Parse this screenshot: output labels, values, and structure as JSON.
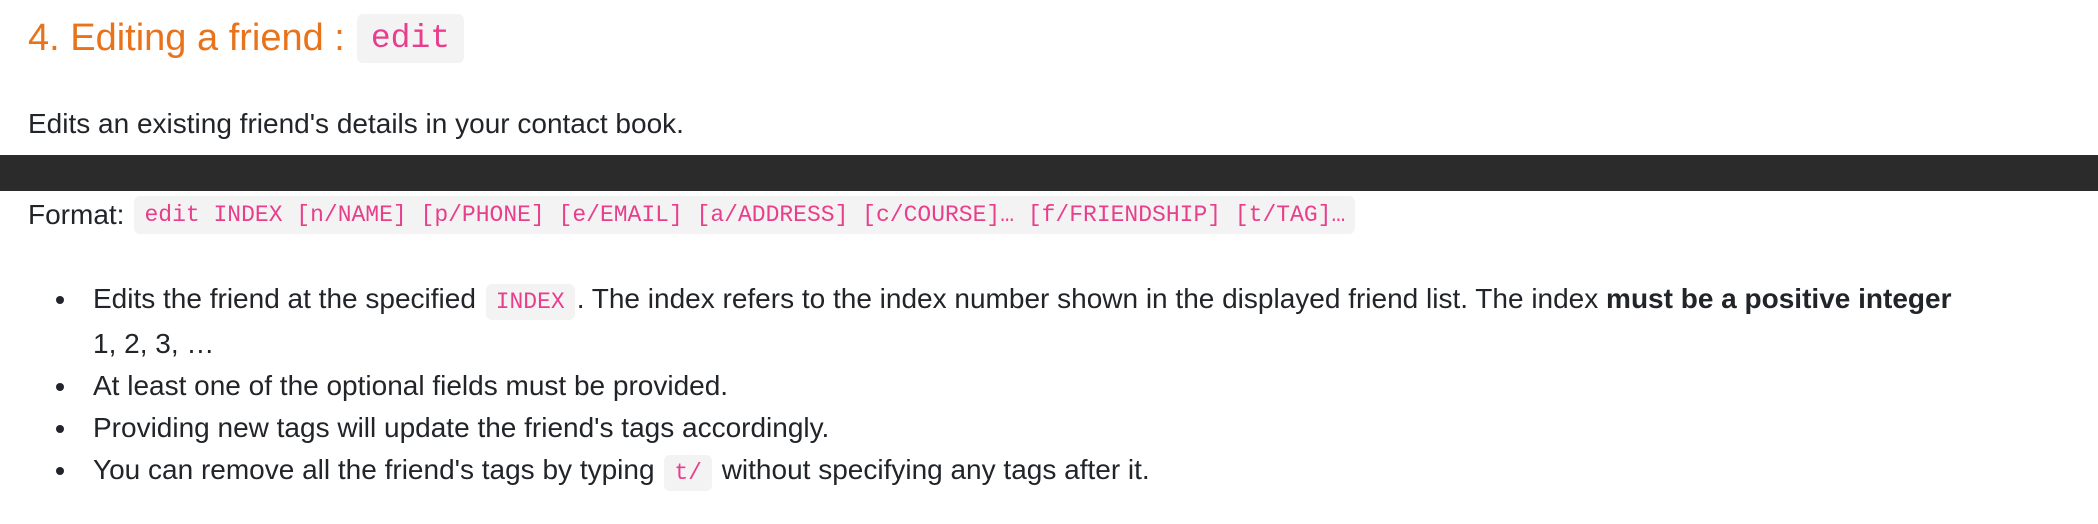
{
  "section": {
    "heading": "4. Editing a friend :",
    "command": "edit",
    "intro": "Edits an existing friend's details in your contact book."
  },
  "format": {
    "label": "Format:",
    "code": "edit INDEX [n/NAME] [p/PHONE] [e/EMAIL] [a/ADDRESS] [c/COURSE]… [f/FRIENDSHIP] [t/TAG]…"
  },
  "bullets": {
    "b1": {
      "pre": "Edits the friend at the specified",
      "code": "INDEX",
      "mid": ". The index refers to the index number shown in the displayed friend list. The index",
      "bold": "must be a positive integer",
      "cont": "1, 2, 3, …"
    },
    "b2": "At least one of the optional fields must be provided.",
    "b3": "Providing new tags will update the friend's tags accordingly.",
    "b4": {
      "pre": "You can remove all the friend's tags by typing",
      "code": "t/",
      "post": "without specifying any tags after it."
    }
  }
}
